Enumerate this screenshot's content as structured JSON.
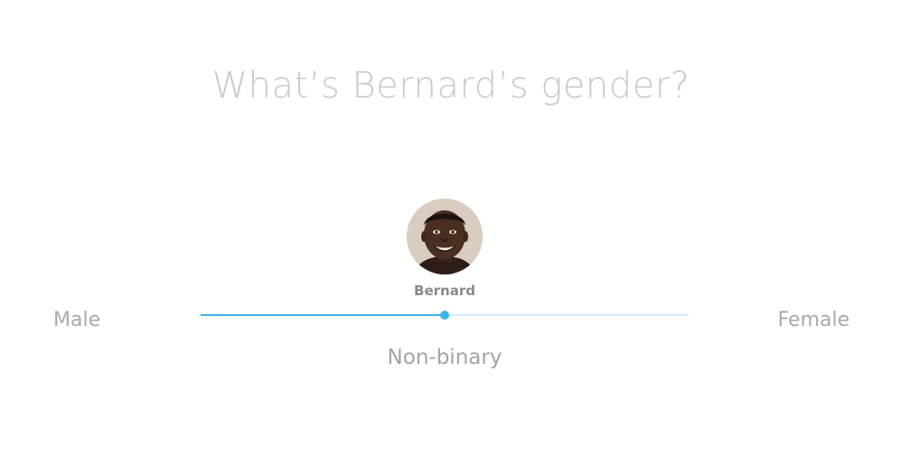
{
  "question": {
    "title": "What’s Bernard’s gender?"
  },
  "person": {
    "name": "Bernard",
    "avatar_icon": "person-photo"
  },
  "slider": {
    "min_label": "Male",
    "max_label": "Female",
    "value_label": "Non-binary",
    "value_fraction": 0.5,
    "accent_color": "#3bb5ea",
    "track_color": "#d3ecfa"
  }
}
